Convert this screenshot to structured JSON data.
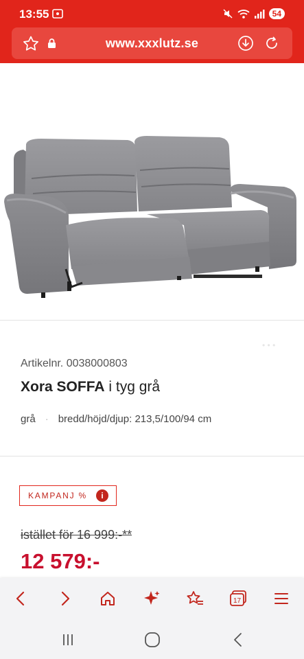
{
  "status_bar": {
    "time": "13:55",
    "battery": "54",
    "background_color": "#e1251b"
  },
  "url_bar": {
    "url": "www.xxxlutz.se",
    "icons": [
      "bookmark-star-icon",
      "lock-icon",
      "download-icon",
      "refresh-icon"
    ]
  },
  "product": {
    "article_nr": "Artikelnr. 0038000803",
    "name_bold": "Xora SOFFA",
    "name_rest": " i tyg grå",
    "color": "grå",
    "dimensions": "bredd/höjd/djup: 213,5/100/94 cm",
    "gallery_dots": "• • •"
  },
  "pricing": {
    "campaign_label": "KAMPANJ %",
    "info_icon": "i",
    "old_price": "istället för 16 999:-**",
    "new_price": "12 579:-",
    "accent_color": "#c8102e"
  },
  "browser_nav": {
    "tabs_count": "17",
    "items": [
      "back-icon",
      "forward-icon",
      "home-icon",
      "sparkle-icon",
      "bookmarks-icon",
      "tabs-icon",
      "menu-icon"
    ]
  },
  "system_nav": {
    "items": [
      "recent-apps-icon",
      "home-circle-icon",
      "system-back-icon"
    ]
  }
}
